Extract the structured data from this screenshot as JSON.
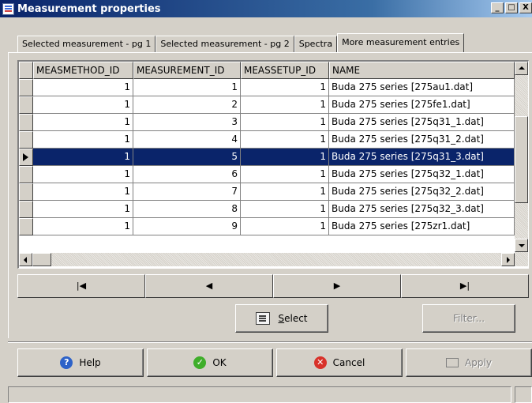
{
  "window": {
    "title": "Measurement properties",
    "controls": [
      "_",
      "□",
      "X"
    ]
  },
  "tabs": [
    {
      "label": "Selected measurement - pg 1",
      "active": false
    },
    {
      "label": "Selected measurement - pg 2",
      "active": false
    },
    {
      "label": "Spectra",
      "active": false
    },
    {
      "label": "More measurement entries",
      "active": true
    }
  ],
  "grid": {
    "columns": [
      "MEASMETHOD_ID",
      "MEASUREMENT_ID",
      "MEASSETUP_ID",
      "NAME"
    ],
    "rows": [
      {
        "method": "1",
        "meas": "1",
        "setup": "1",
        "name": "Buda 275 series [275au1.dat]"
      },
      {
        "method": "1",
        "meas": "2",
        "setup": "1",
        "name": "Buda 275 series [275fe1.dat]"
      },
      {
        "method": "1",
        "meas": "3",
        "setup": "1",
        "name": "Buda 275 series [275q31_1.dat]"
      },
      {
        "method": "1",
        "meas": "4",
        "setup": "1",
        "name": "Buda 275 series [275q31_2.dat]"
      },
      {
        "method": "1",
        "meas": "5",
        "setup": "1",
        "name": "Buda 275 series [275q31_3.dat]"
      },
      {
        "method": "1",
        "meas": "6",
        "setup": "1",
        "name": "Buda 275 series [275q32_1.dat]"
      },
      {
        "method": "1",
        "meas": "7",
        "setup": "1",
        "name": "Buda 275 series [275q32_2.dat]"
      },
      {
        "method": "1",
        "meas": "8",
        "setup": "1",
        "name": "Buda 275 series [275q32_3.dat]"
      },
      {
        "method": "1",
        "meas": "9",
        "setup": "1",
        "name": "Buda 275 series [275zr1.dat]"
      }
    ],
    "selected_row": 4
  },
  "navigator": {
    "first": "|◀",
    "prior": "◀",
    "next": "▶",
    "last": "▶|"
  },
  "actions": {
    "select_label": "Select",
    "select_underline": "S",
    "filter_label": "Filter..."
  },
  "footer": {
    "help_label": "Help",
    "ok_label": "OK",
    "cancel_label": "Cancel",
    "apply_label": "Apply"
  },
  "icons": {
    "help": "question-icon",
    "ok": "checkmark-icon",
    "cancel": "x-circle-icon",
    "apply": "apply-icon",
    "select": "select-icon"
  }
}
